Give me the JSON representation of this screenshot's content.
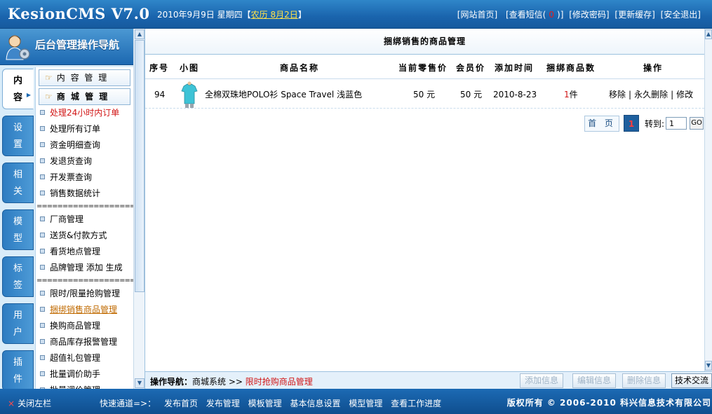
{
  "header": {
    "logo": "KesionCMS V7.0",
    "date": "2010年9月9日 星期四【",
    "lunar": "农历 8月2日",
    "date_end": "】",
    "links": {
      "home": "[网站首页]",
      "messages_prefix": "[查看短信(",
      "messages_count": "0",
      "messages_suffix": ")]",
      "password": "[修改密码]",
      "cache": "[更新缓存]",
      "logout": "[安全退出]"
    }
  },
  "sidebar": {
    "title": "后台管理操作导航",
    "tabs": [
      {
        "line1": "内",
        "line2": "容"
      },
      {
        "line1": "设",
        "line2": "置"
      },
      {
        "line1": "相",
        "line2": "关"
      },
      {
        "line1": "模",
        "line2": "型"
      },
      {
        "line1": "标",
        "line2": "签"
      },
      {
        "line1": "用",
        "line2": "户"
      },
      {
        "line1": "插",
        "line2": "件"
      }
    ],
    "menu_headers": [
      "内 容 管 理",
      "商 城 管 理"
    ],
    "menu_items": {
      "m1": "处理24小时内订单",
      "m2": "处理所有订单",
      "m3": "资金明细查询",
      "m4": "发退货查询",
      "m5": "开发票查询",
      "m6": "销售数据统计",
      "sep1": "====================",
      "m7": "厂商管理",
      "m8": "送货&付款方式",
      "m9": "看货地点管理",
      "m10": "品牌管理 添加 生成",
      "sep2": "====================",
      "m11": "限时/限量抢购管理",
      "m12": "捆绑销售商品管理",
      "m13": "换购商品管理",
      "m14": "商品库存报警管理",
      "m15": "超值礼包管理",
      "m16": "批量调价助手",
      "m17": "批量调价管理"
    }
  },
  "main": {
    "title": "捆绑销售的商品管理",
    "columns": {
      "id": "序号",
      "thumb": "小图",
      "name": "商品名称",
      "price": "当前零售价",
      "member_price": "会员价",
      "added": "添加时间",
      "bundle_count": "捆绑商品数",
      "ops": "操作"
    },
    "row": {
      "id": "94",
      "name": "全棉双珠地POLO衫 Space Travel 浅蓝色",
      "price": "50 元",
      "member_price": "50 元",
      "added": "2010-8-23",
      "count": "1",
      "count_unit": " 件",
      "op_remove": "移除",
      "sep": "|",
      "op_delete": "永久删除",
      "op_edit": "修改"
    },
    "pager": {
      "first": "首 页",
      "current": "1",
      "jump_label": "转到:",
      "input_value": "1",
      "go": "GO"
    }
  },
  "actionbar": {
    "label": "操作导航：",
    "path": "商城系统 >> ",
    "link": "限时抢购商品管理",
    "buttons": {
      "add": "添加信息",
      "edit": "编辑信息",
      "delete": "删除信息",
      "tech": "技术交流"
    }
  },
  "statusbar": {
    "close_icon": "×",
    "close_left": "关闭左栏",
    "quick_label": "快速通道=>：",
    "quick_links": [
      "发布首页",
      "发布管理",
      "模板管理",
      "基本信息设置",
      "模型管理",
      "查看工作进度"
    ],
    "copyright": "版权所有 © 2006-2010 科兴信息技术有限公司"
  },
  "colors": {
    "accent": "#1c68b1",
    "highlight_red": "#d11515",
    "lunar": "#ffe24a"
  }
}
